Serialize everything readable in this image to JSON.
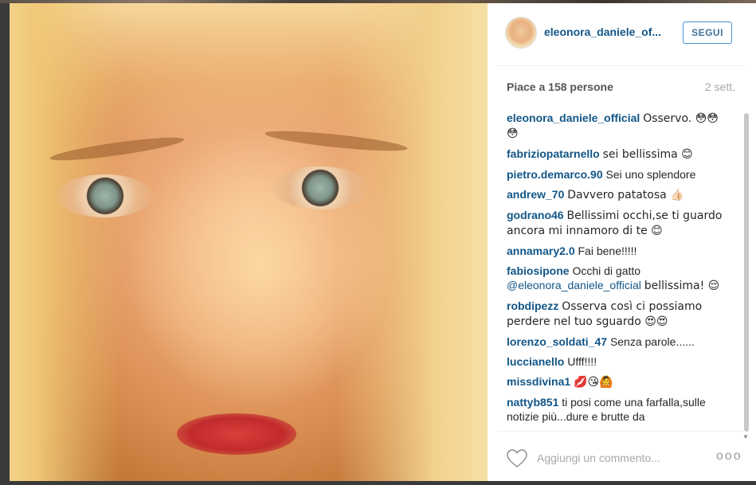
{
  "post": {
    "author": "eleonora_daniele_of...",
    "follow_label": "SEGUI",
    "likes_text": "Piace a 158 persone",
    "time_ago": "2 sett."
  },
  "comments": [
    {
      "user": "eleonora_daniele_official",
      "text": "Osservo. 😳😳😳"
    },
    {
      "user": "fabriziopatarnello",
      "text": "sei bellissima 😊"
    },
    {
      "user": "pietro.demarco.90",
      "text": "Sei uno splendore"
    },
    {
      "user": "andrew_70",
      "text": "Davvero patatosa 👍🏻"
    },
    {
      "user": "godrano46",
      "text": "Bellissimi occhi,se ti guardo ancora mi innamoro di te 😊"
    },
    {
      "user": "annamary2.0",
      "text": "Fai bene!!!!!"
    },
    {
      "user": "fabiosipone",
      "text": "Occhi di gatto",
      "mention": "@eleonora_daniele_official",
      "text_after": "bellissima! 😌"
    },
    {
      "user": "robdipezz",
      "text": "Osserva così ci possiamo perdere nel tuo sguardo 😍😍"
    },
    {
      "user": "lorenzo_soldati_47",
      "text": "Senza parole......"
    },
    {
      "user": "luccianello",
      "text": "Ufff!!!!"
    },
    {
      "user": "missdivina1",
      "text": "💋😘🙆"
    },
    {
      "user": "nattyb851",
      "text": "ti posi come una farfalla,sulle notizie più...dure e brutte da"
    }
  ],
  "footer": {
    "comment_placeholder": "Aggiungi un commento...",
    "more_label": "ooo"
  }
}
